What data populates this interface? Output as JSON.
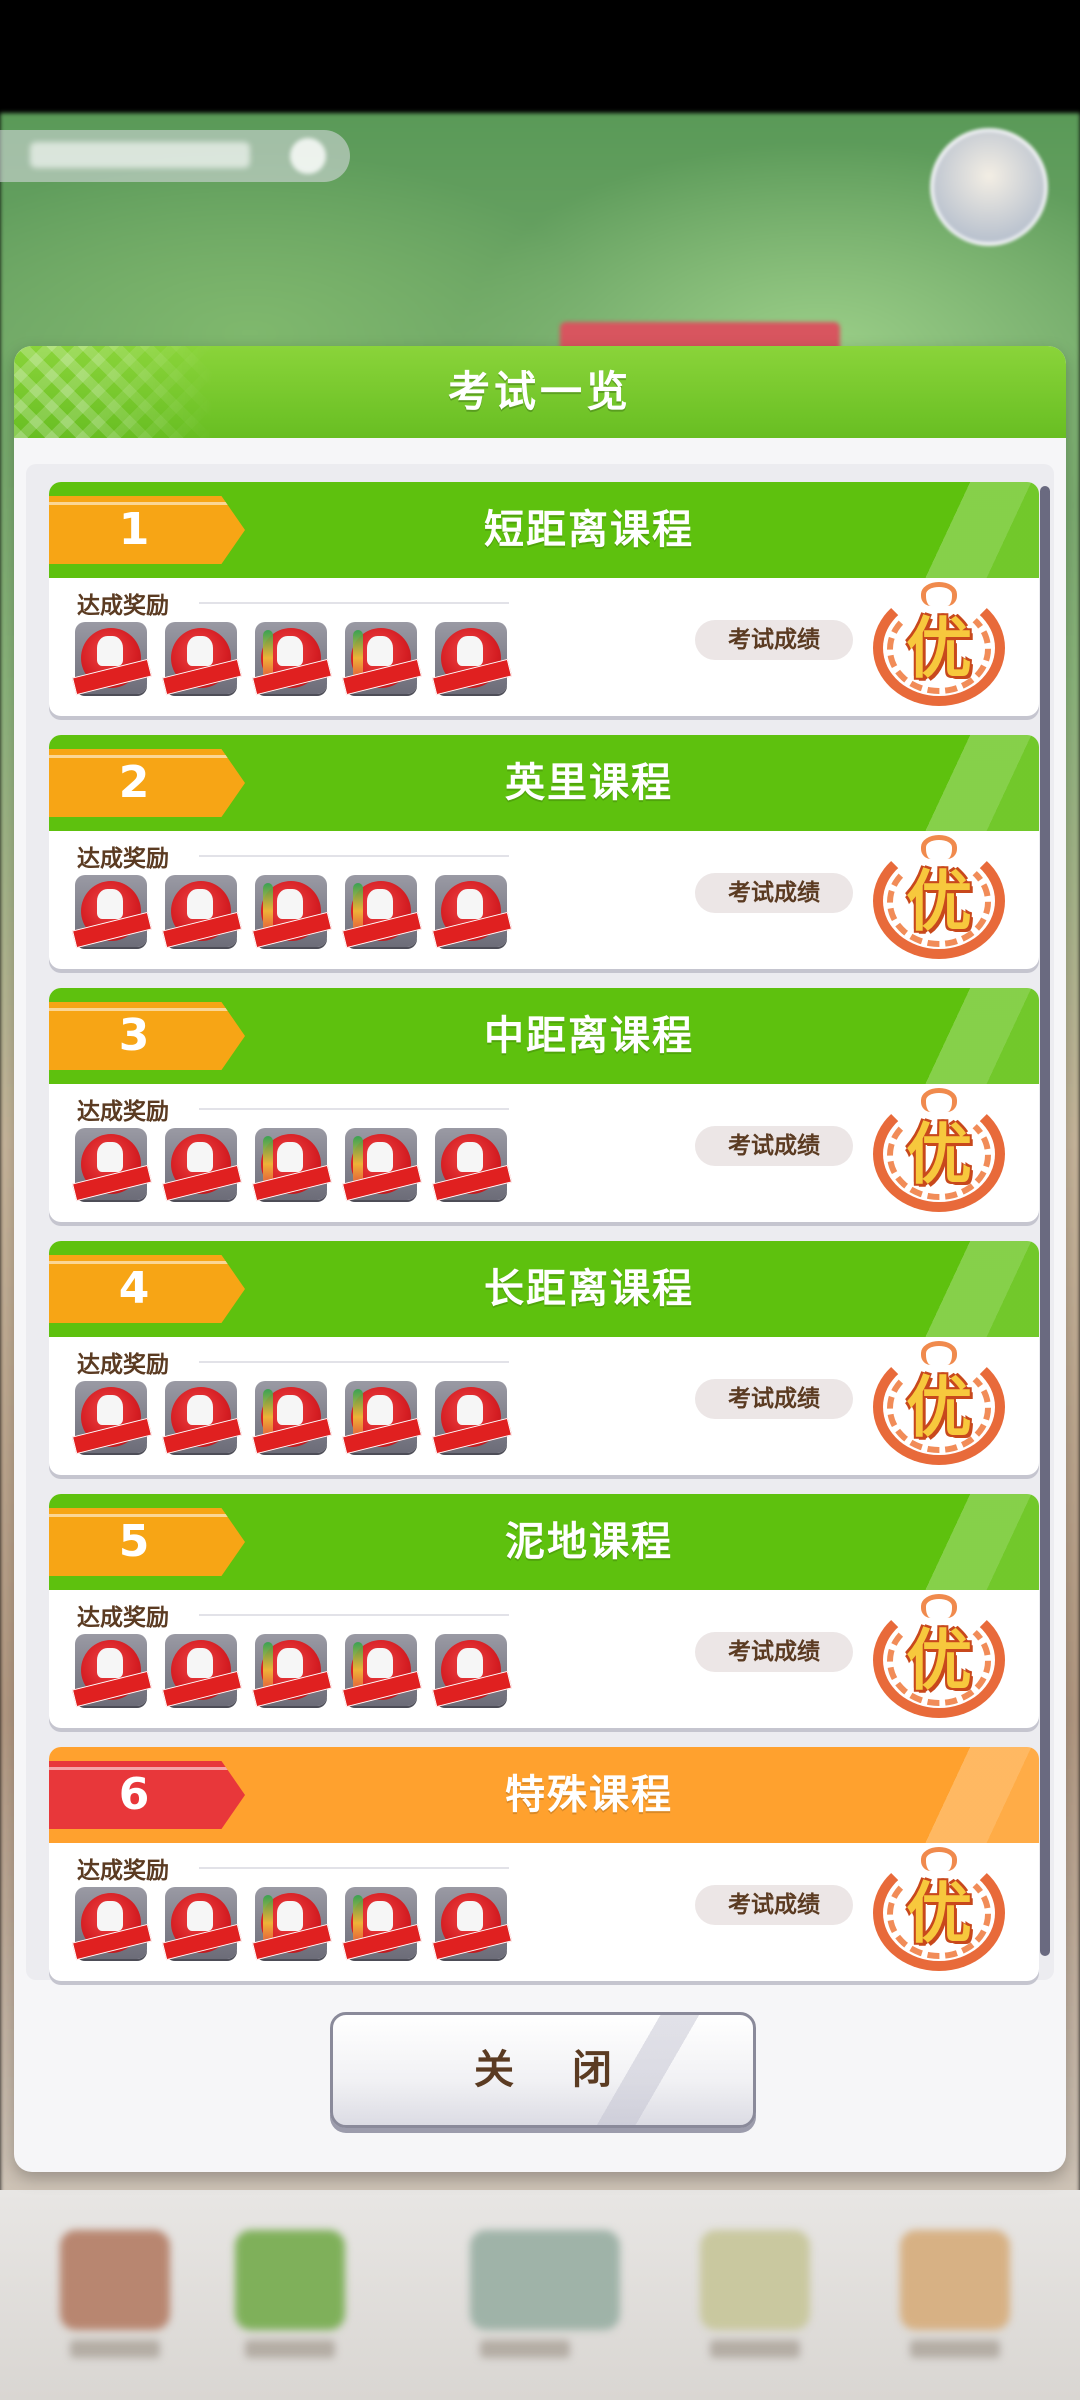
{
  "dialog": {
    "title": "考试一览",
    "close_label": "关 闭"
  },
  "courses": [
    {
      "number": "1",
      "name": "短距离课程",
      "reward_label": "达成奖励",
      "score_label": "考试成绩",
      "grade": "优",
      "variant": "normal"
    },
    {
      "number": "2",
      "name": "英里课程",
      "reward_label": "达成奖励",
      "score_label": "考试成绩",
      "grade": "优",
      "variant": "normal"
    },
    {
      "number": "3",
      "name": "中距离课程",
      "reward_label": "达成奖励",
      "score_label": "考试成绩",
      "grade": "优",
      "variant": "normal"
    },
    {
      "number": "4",
      "name": "长距离课程",
      "reward_label": "达成奖励",
      "score_label": "考试成绩",
      "grade": "优",
      "variant": "normal"
    },
    {
      "number": "5",
      "name": "泥地课程",
      "reward_label": "达成奖励",
      "score_label": "考试成绩",
      "grade": "优",
      "variant": "normal"
    },
    {
      "number": "6",
      "name": "特殊课程",
      "reward_label": "达成奖励",
      "score_label": "考试成绩",
      "grade": "优",
      "variant": "special"
    }
  ],
  "reward_icon": "completed-shoe-badge-icon",
  "colors": {
    "header_green": "#68be22",
    "course_green": "#5ec10e",
    "course_special": "#ffa12e",
    "tag_orange": "#f7a515",
    "tag_red": "#e8373a",
    "text_brown": "#5b3b22"
  }
}
